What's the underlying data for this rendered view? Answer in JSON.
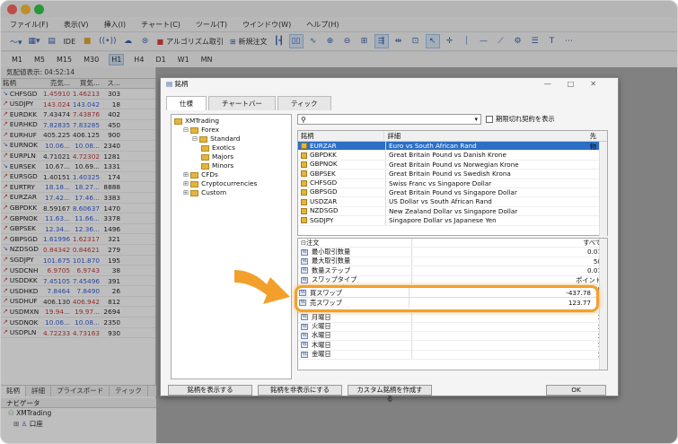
{
  "menu": [
    "ファイル(F)",
    "表示(V)",
    "挿入(I)",
    "チャート(C)",
    "ツール(T)",
    "ウインドウ(W)",
    "ヘルプ(H)"
  ],
  "toolbar": {
    "ide": "IDE",
    "algo": "アルゴリズム取引",
    "new_order": "新規注文"
  },
  "timeframes": [
    "M1",
    "M5",
    "M15",
    "M30",
    "H1",
    "H4",
    "D1",
    "W1",
    "MN"
  ],
  "active_timeframe": "H1",
  "market_watch": {
    "title": "気配値表示: 04:52:14",
    "headers": [
      "銘柄",
      "売気...",
      "買気...",
      "ス..."
    ],
    "rows": [
      {
        "sym": "CHFSGD",
        "bid": "1.45910",
        "ask": "1.46213",
        "sp": "303",
        "bc": "up",
        "ac": "up",
        "d": "dn"
      },
      {
        "sym": "USDJPY",
        "bid": "143.024",
        "ask": "143.042",
        "sp": "18",
        "bc": "up",
        "ac": "dn",
        "d": "up"
      },
      {
        "sym": "EURDKK",
        "bid": "7.43474",
        "ask": "7.43876",
        "sp": "402",
        "bc": "nt",
        "ac": "up",
        "d": "up"
      },
      {
        "sym": "EURHKD",
        "bid": "7.82835",
        "ask": "7.83285",
        "sp": "450",
        "bc": "dn",
        "ac": "dn",
        "d": "up"
      },
      {
        "sym": "EURHUF",
        "bid": "405.225",
        "ask": "406.125",
        "sp": "900",
        "bc": "nt",
        "ac": "nt",
        "d": "up"
      },
      {
        "sym": "EURNOK",
        "bid": "10.06...",
        "ask": "10.08...",
        "sp": "2340",
        "bc": "dn",
        "ac": "dn",
        "d": "dn"
      },
      {
        "sym": "EURPLN",
        "bid": "4.71021",
        "ask": "4.72302",
        "sp": "1281",
        "bc": "nt",
        "ac": "up",
        "d": "up"
      },
      {
        "sym": "EURSEK",
        "bid": "10.67...",
        "ask": "10.69...",
        "sp": "1331",
        "bc": "nt",
        "ac": "nt",
        "d": "dn"
      },
      {
        "sym": "EURSGD",
        "bid": "1.40151",
        "ask": "1.40325",
        "sp": "174",
        "bc": "nt",
        "ac": "dn",
        "d": "up"
      },
      {
        "sym": "EURTRY",
        "bid": "18.18...",
        "ask": "18.27...",
        "sp": "8888",
        "bc": "dn",
        "ac": "dn",
        "d": "up"
      },
      {
        "sym": "EURZAR",
        "bid": "17.42...",
        "ask": "17.46...",
        "sp": "3383",
        "bc": "dn",
        "ac": "dn",
        "d": "up"
      },
      {
        "sym": "GBPDKK",
        "bid": "8.59167",
        "ask": "8.60637",
        "sp": "1470",
        "bc": "nt",
        "ac": "dn",
        "d": "up"
      },
      {
        "sym": "GBPNOK",
        "bid": "11.63...",
        "ask": "11.66...",
        "sp": "3378",
        "bc": "dn",
        "ac": "dn",
        "d": "up"
      },
      {
        "sym": "GBPSEK",
        "bid": "12.34...",
        "ask": "12.36...",
        "sp": "1496",
        "bc": "dn",
        "ac": "dn",
        "d": "up"
      },
      {
        "sym": "GBPSGD",
        "bid": "1.61996",
        "ask": "1.62317",
        "sp": "321",
        "bc": "dn",
        "ac": "up",
        "d": "up"
      },
      {
        "sym": "NZDSGD",
        "bid": "0.84342",
        "ask": "0.84621",
        "sp": "279",
        "bc": "up",
        "ac": "up",
        "d": "dn"
      },
      {
        "sym": "SGDJPY",
        "bid": "101.675",
        "ask": "101.870",
        "sp": "195",
        "bc": "dn",
        "ac": "dn",
        "d": "up"
      },
      {
        "sym": "USDCNH",
        "bid": "6.9705",
        "ask": "6.9743",
        "sp": "38",
        "bc": "up",
        "ac": "up",
        "d": "up"
      },
      {
        "sym": "USDDKK",
        "bid": "7.45105",
        "ask": "7.45496",
        "sp": "391",
        "bc": "dn",
        "ac": "dn",
        "d": "up"
      },
      {
        "sym": "USDHKD",
        "bid": "7.8464",
        "ask": "7.8490",
        "sp": "26",
        "bc": "dn",
        "ac": "dn",
        "d": "up"
      },
      {
        "sym": "USDHUF",
        "bid": "406.130",
        "ask": "406.942",
        "sp": "812",
        "bc": "nt",
        "ac": "up",
        "d": "up"
      },
      {
        "sym": "USDMXN",
        "bid": "19.94...",
        "ask": "19.97...",
        "sp": "2694",
        "bc": "up",
        "ac": "up",
        "d": "up"
      },
      {
        "sym": "USDNOK",
        "bid": "10.06...",
        "ask": "10.08...",
        "sp": "2350",
        "bc": "dn",
        "ac": "dn",
        "d": "up"
      },
      {
        "sym": "USDPLN",
        "bid": "4.72233",
        "ask": "4.73163",
        "sp": "930",
        "bc": "up",
        "ac": "up",
        "d": "up"
      }
    ],
    "tabs": [
      "銘柄",
      "詳細",
      "プライスボード",
      "ティック"
    ]
  },
  "navigator": {
    "title": "ナビゲータ",
    "items": [
      "XMTrading",
      "口座"
    ]
  },
  "dialog": {
    "title": "銘柄",
    "tabs": [
      "仕様",
      "チャートバー",
      "ティック"
    ],
    "tree": [
      {
        "label": "XMTrading",
        "level": 0
      },
      {
        "label": "Forex",
        "level": 1
      },
      {
        "label": "Standard",
        "level": 2
      },
      {
        "label": "Exotics",
        "level": 3
      },
      {
        "label": "Majors",
        "level": 3
      },
      {
        "label": "Minors",
        "level": 3
      },
      {
        "label": "CFDs",
        "level": 1
      },
      {
        "label": "Cryptocurrencies",
        "level": 1
      },
      {
        "label": "Custom",
        "level": 1
      }
    ],
    "search_placeholder": "",
    "expired_label": "期限切れ契約を表示",
    "sym_headers": [
      "銘柄",
      "詳細",
      "先物"
    ],
    "symbols": [
      {
        "s": "EURZAR",
        "d": "Euro vs South African Rand",
        "sel": true
      },
      {
        "s": "GBPDKK",
        "d": "Great Britain Pound vs Danish Krone"
      },
      {
        "s": "GBPNOK",
        "d": "Great Britain Pound vs Norwegian Krone"
      },
      {
        "s": "GBPSEK",
        "d": "Great Britain Pound vs Swedish Krona"
      },
      {
        "s": "CHFSGD",
        "d": "Swiss Franc vs Singapore Dollar"
      },
      {
        "s": "GBPSGD",
        "d": "Great Britain Pound vs Singapore Dollar"
      },
      {
        "s": "USDZAR",
        "d": "US Dollar vs South African Rand"
      },
      {
        "s": "NZDSGD",
        "d": "New Zealand Dollar vs Singapore Dollar"
      },
      {
        "s": "SGDJPY",
        "d": "Singapore Dollar vs Japanese Yen"
      }
    ],
    "props": [
      {
        "k": "注文",
        "v": "すべて",
        "head": true
      },
      {
        "k": "最小取引数量",
        "v": "0.01"
      },
      {
        "k": "最大取引数量",
        "v": "50"
      },
      {
        "k": "数量ステップ",
        "v": "0.01"
      },
      {
        "k": "スワップタイプ",
        "v": "ポイント"
      },
      {
        "k": "買スワップ",
        "v": "-437.78"
      },
      {
        "k": "売スワップ",
        "v": "123.77"
      },
      {
        "k": "スワップレート",
        "v": "",
        "head": true
      },
      {
        "k": "月曜日",
        "v": "1"
      },
      {
        "k": "火曜日",
        "v": "1"
      },
      {
        "k": "水曜日",
        "v": "3"
      },
      {
        "k": "木曜日",
        "v": "1"
      },
      {
        "k": "金曜日",
        "v": "1"
      }
    ],
    "buttons": [
      "銘柄を表示する",
      "銘柄を非表示にする",
      "カスタム銘柄を作成する"
    ],
    "ok": "OK"
  },
  "colors": {
    "accent": "#f2a02b",
    "selection": "#2b6fc6",
    "up": "#c03030",
    "down": "#2c55d4"
  }
}
